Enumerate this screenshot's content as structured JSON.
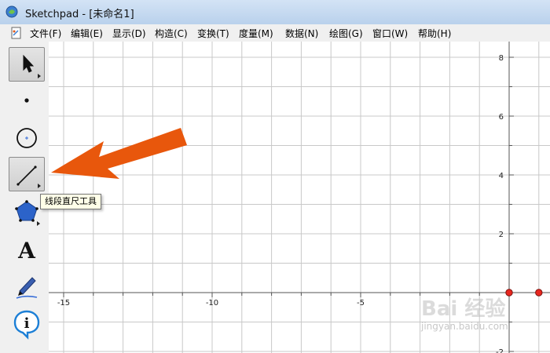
{
  "window": {
    "title": "Sketchpad  - [未命名1]"
  },
  "menubar": {
    "items": [
      "文件(F)",
      "编辑(E)",
      "显示(D)",
      "构造(C)",
      "变换(T)",
      "度量(M)",
      "数据(N)",
      "绘图(G)",
      "窗口(W)",
      "帮助(H)"
    ]
  },
  "toolbox": {
    "tools": [
      {
        "name": "arrow-select-tool",
        "icon": "arrow-cursor-icon",
        "selected": true
      },
      {
        "name": "point-tool",
        "icon": "point-icon",
        "selected": false
      },
      {
        "name": "compass-tool",
        "icon": "circle-icon",
        "selected": false
      },
      {
        "name": "straightedge-tool",
        "icon": "segment-icon",
        "selected": true
      },
      {
        "name": "polygon-tool",
        "icon": "pentagon-icon",
        "selected": false
      },
      {
        "name": "text-tool",
        "icon": "letter-a-icon",
        "selected": false
      },
      {
        "name": "marker-tool",
        "icon": "pen-icon",
        "selected": false
      },
      {
        "name": "information-tool",
        "icon": "info-icon",
        "selected": false
      }
    ],
    "tooltip": "线段直尺工具"
  },
  "graph": {
    "x_tick_labels": [
      "-15",
      "-10",
      "-5"
    ],
    "y_tick_labels": [
      "8",
      "6",
      "4",
      "2",
      "-2"
    ],
    "points": [
      {
        "x": 0,
        "y": 0
      },
      {
        "x": 1,
        "y": 0
      }
    ],
    "point_color": "#e8261e"
  },
  "annotation": {
    "arrow_color": "#e8570c"
  },
  "watermark": {
    "logo": "Bai 经验",
    "sub": "jingyan.baidu.com"
  }
}
